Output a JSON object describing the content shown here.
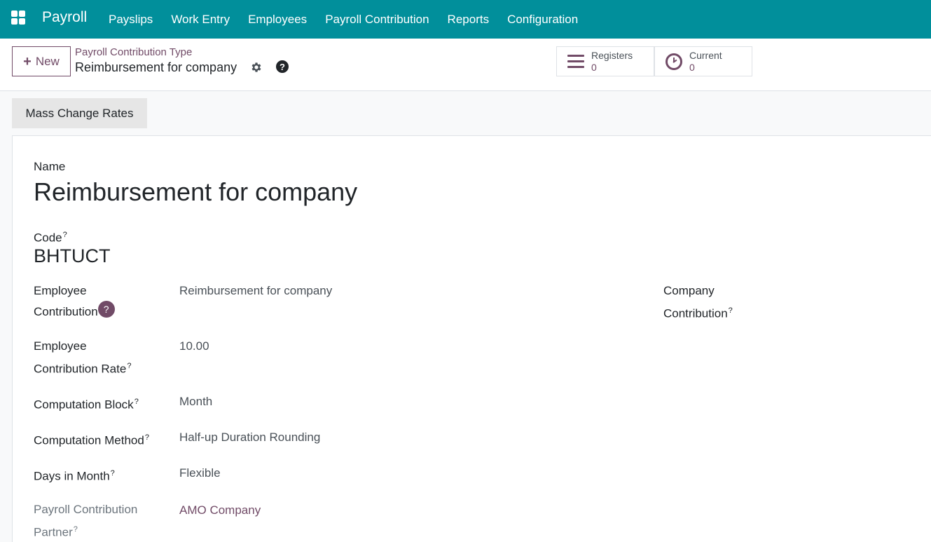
{
  "navbar": {
    "brand": "Payroll",
    "menu": [
      "Payslips",
      "Work Entry",
      "Employees",
      "Payroll Contribution",
      "Reports",
      "Configuration"
    ]
  },
  "control": {
    "new_label": "New",
    "breadcrumb": "Payroll Contribution Type",
    "record_title": "Reimbursement for company",
    "stats": {
      "registers": {
        "label": "Registers",
        "value": "0"
      },
      "current": {
        "label": "Current",
        "value": "0"
      }
    }
  },
  "actions": {
    "mass_change_label": "Mass Change Rates"
  },
  "form": {
    "name_label": "Name",
    "name_value": "Reimbursement for company",
    "code_label": "Code",
    "code_value": "BHTUCT",
    "employee_contribution_label_1": "Employee",
    "employee_contribution_label_2": "Contribution",
    "employee_contribution_value": "Reimbursement for company",
    "company_contribution_label_1": "Company",
    "company_contribution_label_2": "Contribution",
    "employee_rate_label_1": "Employee",
    "employee_rate_label_2": "Contribution Rate",
    "employee_rate_value": "10.00",
    "computation_block_label": "Computation Block",
    "computation_block_value": "Month",
    "computation_method_label": "Computation Method",
    "computation_method_value": "Half-up Duration Rounding",
    "days_in_month_label": "Days in Month",
    "days_in_month_value": "Flexible",
    "partner_label_1": "Payroll Contribution",
    "partner_label_2": "Partner",
    "partner_value": "AMO Company",
    "tooltip_mark": "?"
  },
  "colors": {
    "navbar": "#018f9b",
    "accent": "#714b67"
  }
}
